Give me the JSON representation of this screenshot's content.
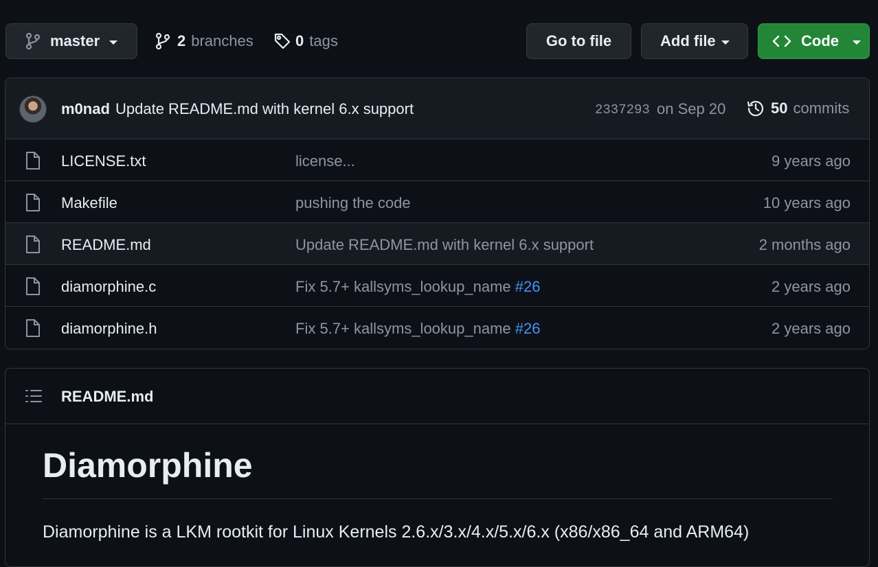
{
  "toolbar": {
    "branch": "master",
    "branches_count": "2",
    "branches_label": "branches",
    "tags_count": "0",
    "tags_label": "tags",
    "go_to_file": "Go to file",
    "add_file": "Add file",
    "code": "Code",
    "code_button_color": "#238636"
  },
  "latest_commit": {
    "author": "m0nad",
    "message": "Update README.md with kernel 6.x support",
    "sha": "2337293",
    "date": "on Sep 20",
    "commits_count": "50",
    "commits_label": "commits"
  },
  "files": [
    {
      "name": "LICENSE.txt",
      "commit": "license...",
      "pr": "",
      "age": "9 years ago",
      "icon": "file-icon"
    },
    {
      "name": "Makefile",
      "commit": "pushing the code",
      "pr": "",
      "age": "10 years ago",
      "icon": "file-icon"
    },
    {
      "name": "README.md",
      "commit": "Update README.md with kernel 6.x support",
      "pr": "",
      "age": "2 months ago",
      "icon": "file-icon"
    },
    {
      "name": "diamorphine.c",
      "commit": "Fix 5.7+ kallsyms_lookup_name ",
      "pr": "#26",
      "age": "2 years ago",
      "icon": "file-icon"
    },
    {
      "name": "diamorphine.h",
      "commit": "Fix 5.7+ kallsyms_lookup_name ",
      "pr": "#26",
      "age": "2 years ago",
      "icon": "file-icon"
    }
  ],
  "readme": {
    "filename": "README.md",
    "heading": "Diamorphine",
    "paragraph": "Diamorphine is a LKM rootkit for Linux Kernels 2.6.x/3.x/4.x/5.x/6.x (x86/x86_64 and ARM64)"
  },
  "colors": {
    "background": "#0d1117",
    "border": "#30363d",
    "link": "#4493f8",
    "muted": "#8d96a0"
  }
}
